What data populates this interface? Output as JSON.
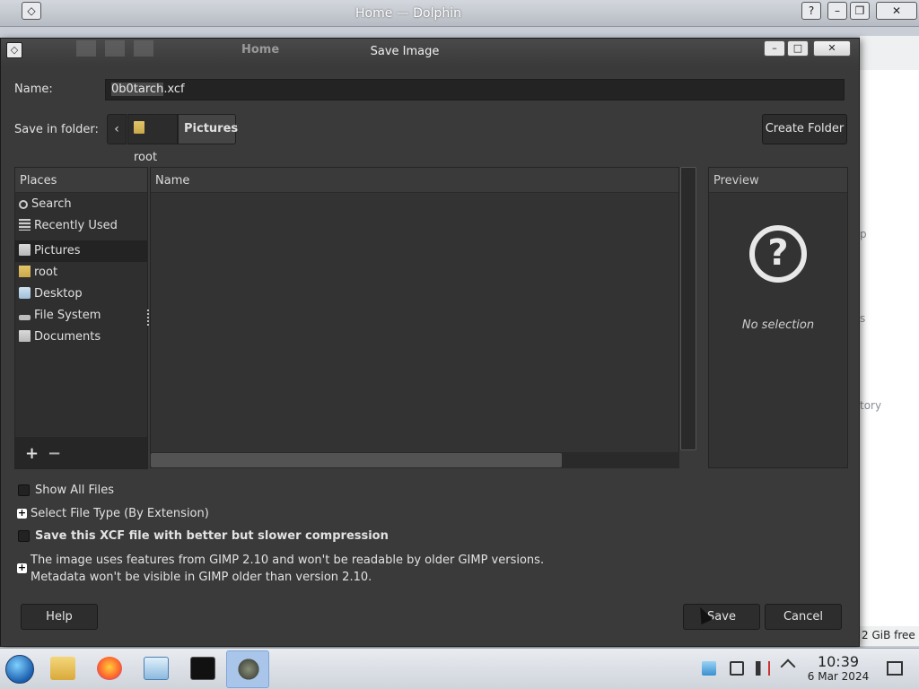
{
  "background_window": {
    "title": "Home — Dolphin",
    "help_btn": "?",
    "free_space": "2 GiB free",
    "ghost_texts": [
      "p",
      "s",
      "tory"
    ]
  },
  "dialog": {
    "title": "Save Image",
    "ghost_breadcrumb": "Home",
    "name_label": "Name:",
    "name_value_selected": "0b0tarch",
    "name_value_ext": ".xcf",
    "folder_label": "Save in folder:",
    "breadcrumbs": [
      "root",
      "Pictures"
    ],
    "create_folder": "Create Folder",
    "places": {
      "header": "Places",
      "items": [
        "Search",
        "Recently Used",
        "Pictures",
        "root",
        "Desktop",
        "File System",
        "Documents"
      ],
      "selected": "Pictures"
    },
    "filelist": {
      "header": "Name"
    },
    "preview": {
      "header": "Preview",
      "no_selection": "No selection"
    },
    "options": {
      "show_all_files": "Show All Files",
      "select_file_type": "Select File Type (By Extension)",
      "better_compression": "Save this XCF file with better but slower compression",
      "compat_line1": "The image uses features from GIMP 2.10 and won't be readable by older GIMP versions.",
      "compat_line2": "Metadata won't be visible in GIMP older than version 2.10."
    },
    "buttons": {
      "help": "Help",
      "save": "Save",
      "cancel": "Cancel"
    }
  },
  "taskbar": {
    "tasks": [
      "file-manager",
      "firefox",
      "system-settings",
      "terminal",
      "gimp"
    ],
    "active_task": "gimp",
    "clock_time": "10:39",
    "clock_date": "6 Mar 2024"
  }
}
